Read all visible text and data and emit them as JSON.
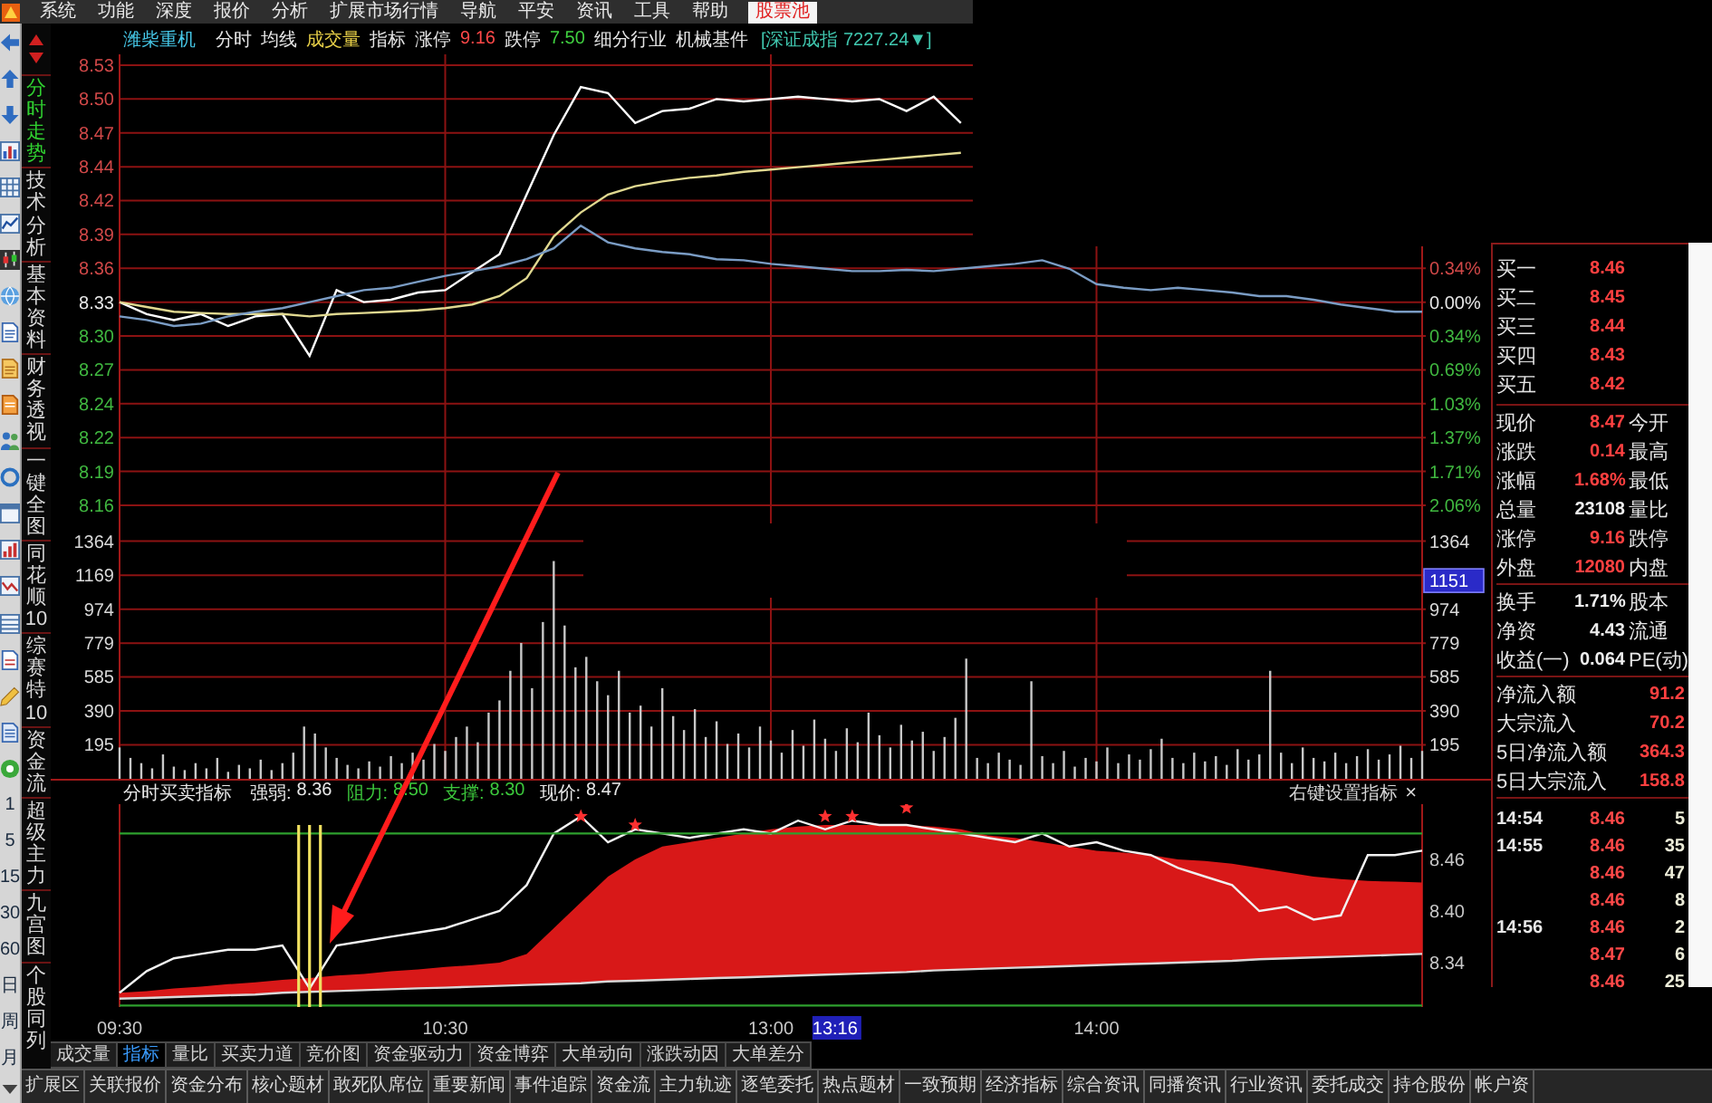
{
  "menu_bar": {
    "items": [
      {
        "label": "系统",
        "selected": false
      },
      {
        "label": "功能",
        "selected": false
      },
      {
        "label": "深度",
        "selected": false
      },
      {
        "label": "报价",
        "selected": false
      },
      {
        "label": "分析",
        "selected": false
      },
      {
        "label": "扩展市场行情",
        "selected": false
      },
      {
        "label": "导航",
        "selected": false
      },
      {
        "label": "平安",
        "selected": false
      },
      {
        "label": "资讯",
        "selected": false
      },
      {
        "label": "工具",
        "selected": false
      },
      {
        "label": "帮助",
        "selected": false
      },
      {
        "label": "股票池",
        "selected": true
      }
    ]
  },
  "toolbar": {
    "period_buttons": [
      "1",
      "5",
      "15",
      "30",
      "60",
      "日",
      "周",
      "月"
    ]
  },
  "side_tabs": [
    {
      "label": "分时走势",
      "selected": true
    },
    {
      "label": "技术分析",
      "selected": false
    },
    {
      "label": "基本资料",
      "selected": false
    },
    {
      "label": "财务透视",
      "selected": false
    },
    {
      "label": "一键全图",
      "selected": false
    },
    {
      "label": "同花顺10",
      "selected": false
    },
    {
      "label": "综赛特10",
      "selected": false
    },
    {
      "label": "资金流",
      "selected": false
    },
    {
      "label": "超级主力",
      "selected": false
    },
    {
      "label": "九宫图",
      "selected": false
    },
    {
      "label": "个股同列",
      "selected": false
    }
  ],
  "quote_header": [
    {
      "text": "潍柴重机",
      "kind": "name",
      "color": "#46c8e8"
    },
    {
      "text": "分时",
      "kind": "toggle",
      "color": "#e6e6e6"
    },
    {
      "text": "均线",
      "kind": "toggle",
      "color": "#e6e6e6"
    },
    {
      "text": "成交量",
      "kind": "toggle",
      "color": "#e8d048"
    },
    {
      "text": "指标",
      "kind": "toggle",
      "color": "#e6e6e6"
    },
    {
      "text": "涨停",
      "kind": "label",
      "color": "#e6e6e6"
    },
    {
      "text": "9.16",
      "kind": "value",
      "color": "#ff4848"
    },
    {
      "text": "跌停",
      "kind": "label",
      "color": "#e6e6e6"
    },
    {
      "text": "7.50",
      "kind": "value",
      "color": "#40d040"
    },
    {
      "text": "细分行业",
      "kind": "label",
      "color": "#e6e6e6"
    },
    {
      "text": "机械基件",
      "kind": "value",
      "color": "#e6e6e6"
    },
    {
      "text": "[深证成指 7227.24▼]",
      "kind": "index",
      "color": "#40c8b0"
    }
  ],
  "price_panel": {
    "chart_data": {
      "type": "line",
      "grid": true,
      "ylim": [
        8.1448,
        8.5374
      ],
      "yticks": [
        {
          "value": 8.5283,
          "label": "8.53"
        },
        {
          "value": 8.5,
          "label": "8.50"
        },
        {
          "value": 8.4717,
          "label": "8.47"
        },
        {
          "value": 8.4433,
          "label": "8.44"
        },
        {
          "value": 8.415,
          "label": "8.42"
        },
        {
          "value": 8.3867,
          "label": "8.39"
        },
        {
          "value": 8.3583,
          "label": "8.36"
        },
        {
          "value": 8.33,
          "label": "8.33"
        },
        {
          "value": 8.3017,
          "label": "8.30"
        },
        {
          "value": 8.2733,
          "label": "8.27"
        },
        {
          "value": 8.245,
          "label": "8.24"
        },
        {
          "value": 8.2167,
          "label": "8.22"
        },
        {
          "value": 8.1883,
          "label": "8.19"
        },
        {
          "value": 8.16,
          "label": "8.16"
        }
      ],
      "series": [
        {
          "color": "#ffffff",
          "values": [
            8.33,
            8.32,
            8.315,
            8.32,
            8.31,
            8.318,
            8.32,
            8.285,
            8.34,
            8.33,
            8.332,
            8.338,
            8.34,
            8.355,
            8.37,
            8.42,
            8.47,
            8.51,
            8.505,
            8.48,
            8.49,
            8.492,
            8.5,
            8.498,
            8.5,
            8.502,
            8.5,
            8.498,
            8.5,
            8.49,
            8.502,
            8.48,
            null,
            null,
            null,
            null,
            null,
            null,
            null,
            null,
            null,
            null,
            null,
            null,
            null,
            null,
            null,
            null,
            null
          ]
        },
        {
          "color": "#e0d890",
          "values": [
            8.33,
            8.326,
            8.322,
            8.321,
            8.32,
            8.32,
            8.32,
            8.318,
            8.32,
            8.321,
            8.322,
            8.323,
            8.325,
            8.328,
            8.335,
            8.35,
            8.385,
            8.405,
            8.42,
            8.427,
            8.431,
            8.434,
            8.436,
            8.439,
            8.441,
            8.443,
            8.445,
            8.447,
            8.449,
            8.451,
            8.453,
            8.455,
            null,
            null,
            null,
            null,
            null,
            null,
            null,
            null,
            null,
            null,
            null,
            null,
            null,
            null,
            null,
            null,
            null
          ]
        },
        {
          "color": "#7a9cc4",
          "values": [
            8.318,
            8.315,
            8.31,
            8.312,
            8.318,
            8.322,
            8.325,
            8.33,
            8.335,
            8.34,
            8.342,
            8.347,
            8.352,
            8.356,
            8.36,
            8.366,
            8.375,
            8.394,
            8.38,
            8.375,
            8.372,
            8.37,
            8.366,
            8.365,
            8.362,
            8.36,
            8.358,
            8.356,
            8.356,
            8.357,
            8.356,
            8.358,
            8.36,
            8.362,
            8.365,
            8.358,
            8.345,
            8.342,
            8.34,
            8.342,
            8.34,
            8.338,
            8.335,
            8.335,
            8.332,
            8.328,
            8.325,
            8.322,
            8.322
          ]
        }
      ]
    },
    "right_axis_labels": [
      {
        "text": "0.34%",
        "kind": "up"
      },
      {
        "text": "0.00%",
        "kind": "flat"
      },
      {
        "text": "0.34%",
        "kind": "down"
      },
      {
        "text": "0.69%",
        "kind": "down"
      },
      {
        "text": "1.03%",
        "kind": "down"
      },
      {
        "text": "1.37%",
        "kind": "down"
      },
      {
        "text": "1.71%",
        "kind": "down"
      },
      {
        "text": "2.06%",
        "kind": "down"
      }
    ]
  },
  "volume_panel": {
    "chart_data": {
      "type": "bar",
      "grid": true,
      "values": [
        180,
        120,
        90,
        60,
        140,
        70,
        50,
        90,
        60,
        120,
        40,
        80,
        60,
        110,
        50,
        90,
        150,
        300,
        260,
        180,
        120,
        80,
        60,
        100,
        70,
        130,
        90,
        150,
        110,
        200,
        160,
        240,
        300,
        210,
        380,
        450,
        620,
        780,
        520,
        900,
        1250,
        880,
        640,
        700,
        560,
        480,
        620,
        380,
        420,
        300,
        520,
        360,
        280,
        400,
        240,
        330,
        200,
        260,
        180,
        300,
        220,
        150,
        280,
        190,
        340,
        230,
        160,
        290,
        210,
        380,
        250,
        180,
        310,
        220,
        270,
        160,
        240,
        350,
        690,
        120,
        90,
        150,
        110,
        80,
        560,
        130,
        90,
        160,
        70,
        120,
        100,
        180,
        90,
        140,
        110,
        170,
        230,
        120,
        90,
        150,
        100,
        130,
        80,
        170,
        110,
        140,
        620,
        150,
        90,
        180,
        120,
        100,
        150,
        90,
        130,
        170,
        110,
        140,
        190,
        120,
        160
      ],
      "ylim": [
        0,
        1466
      ],
      "yticks": [
        {
          "value": 1364,
          "label": "1364"
        },
        {
          "value": 1169,
          "label": "1169"
        },
        {
          "value": 974,
          "label": "974"
        },
        {
          "value": 779,
          "label": "779"
        },
        {
          "value": 585,
          "label": "585"
        },
        {
          "value": 390,
          "label": "390"
        },
        {
          "value": 195,
          "label": "195"
        }
      ]
    },
    "right_axis_labels": [
      {
        "text": "1364",
        "kind": "tick"
      },
      {
        "text": "1151",
        "kind": "cursor"
      },
      {
        "text": "974",
        "kind": "tick"
      },
      {
        "text": "779",
        "kind": "tick"
      },
      {
        "text": "585",
        "kind": "tick"
      },
      {
        "text": "390",
        "kind": "tick"
      },
      {
        "text": "195",
        "kind": "tick"
      }
    ]
  },
  "indicator_panel": {
    "title": "分时买卖指标",
    "legend": [
      {
        "label": "强弱:",
        "value": "8.36",
        "color": "#e8e8e8"
      },
      {
        "label": "阻力:",
        "value": "8.50",
        "color": "#3cc83c"
      },
      {
        "label": "支撑:",
        "value": "8.30",
        "color": "#3cc83c"
      },
      {
        "label": "现价:",
        "value": "8.47",
        "color": "#e8e8e8"
      }
    ],
    "settings_link": "右键设置指标",
    "close": "×",
    "chart_data": {
      "type": "area",
      "categories": [
        "09:30",
        null,
        null,
        null,
        null,
        null,
        null,
        null,
        null,
        null,
        null,
        null,
        "10:30",
        null,
        null,
        null,
        null,
        null,
        null,
        null,
        null,
        null,
        null,
        null,
        "13:00",
        null,
        null,
        null,
        null,
        null,
        null,
        null,
        null,
        null,
        null,
        null,
        "14:00",
        null,
        null,
        null,
        null,
        null,
        null,
        null,
        null,
        null,
        null,
        null,
        null
      ],
      "ylim": [
        8.2884,
        8.5242
      ],
      "yticks": [
        {
          "value": 8.46,
          "label": "8.46"
        },
        {
          "value": 8.4,
          "label": "8.40"
        },
        {
          "value": 8.34,
          "label": "8.34"
        }
      ],
      "series": [
        {
          "type": "area",
          "color": "#d81818",
          "values": [
            8.305,
            8.307,
            8.31,
            8.312,
            8.315,
            8.317,
            8.32,
            8.322,
            8.325,
            8.327,
            8.33,
            8.332,
            8.335,
            8.337,
            8.34,
            8.35,
            8.38,
            8.41,
            8.44,
            8.46,
            8.475,
            8.48,
            8.485,
            8.49,
            8.495,
            8.498,
            8.5,
            8.5,
            8.5,
            8.5,
            8.498,
            8.495,
            8.488,
            8.485,
            8.48,
            8.475,
            8.47,
            8.468,
            8.465,
            8.46,
            8.458,
            8.455,
            8.45,
            8.445,
            8.44,
            8.437,
            8.435,
            8.434,
            8.433
          ]
        },
        {
          "type": "line",
          "color": "#d8d8d8",
          "values": [
            8.298,
            8.299,
            8.3,
            8.301,
            8.302,
            8.303,
            8.305,
            8.306,
            8.307,
            8.308,
            8.309,
            8.31,
            8.311,
            8.312,
            8.313,
            8.314,
            8.315,
            8.316,
            8.318,
            8.319,
            8.32,
            8.321,
            8.322,
            8.323,
            8.324,
            8.325,
            8.326,
            8.327,
            8.328,
            8.329,
            8.331,
            8.332,
            8.333,
            8.334,
            8.335,
            8.336,
            8.337,
            8.338,
            8.339,
            8.34,
            8.341,
            8.342,
            8.344,
            8.345,
            8.346,
            8.347,
            8.348,
            8.349,
            8.35
          ]
        },
        {
          "type": "line",
          "color": "#f2f2f2",
          "values": [
            8.305,
            8.33,
            8.345,
            8.35,
            8.355,
            8.355,
            8.36,
            8.31,
            8.36,
            8.365,
            8.37,
            8.375,
            8.38,
            8.39,
            8.4,
            8.43,
            8.49,
            8.51,
            8.48,
            8.495,
            8.49,
            8.485,
            8.49,
            8.495,
            8.49,
            8.505,
            8.495,
            8.505,
            8.5,
            8.5,
            8.495,
            8.49,
            8.485,
            8.48,
            8.49,
            8.475,
            8.48,
            8.47,
            8.465,
            8.45,
            8.44,
            8.43,
            8.4,
            8.405,
            8.39,
            8.395,
            8.465,
            8.465,
            8.47
          ]
        },
        {
          "type": "line",
          "color": "#2ea02e",
          "values": [
            8.49,
            8.49,
            8.49,
            8.49,
            8.49,
            8.49,
            8.49,
            8.49,
            8.49,
            8.49,
            8.49,
            8.49,
            8.49,
            8.49,
            8.49,
            8.49,
            8.49,
            8.49,
            8.49,
            8.49,
            8.49,
            8.49,
            8.49,
            8.49,
            8.49,
            8.49,
            8.49,
            8.49,
            8.49,
            8.49,
            8.49,
            8.49,
            8.49,
            8.49,
            8.49,
            8.49,
            8.49,
            8.49,
            8.49,
            8.49,
            8.49,
            8.49,
            8.49,
            8.49,
            8.49,
            8.49,
            8.49,
            8.49,
            8.49
          ]
        },
        {
          "type": "line",
          "color": "#2ea02e",
          "values": [
            8.29,
            8.29,
            8.29,
            8.29,
            8.29,
            8.29,
            8.29,
            8.29,
            8.29,
            8.29,
            8.29,
            8.29,
            8.29,
            8.29,
            8.29,
            8.29,
            8.29,
            8.29,
            8.29,
            8.29,
            8.29,
            8.29,
            8.29,
            8.29,
            8.29,
            8.29,
            8.29,
            8.29,
            8.29,
            8.29,
            8.29,
            8.29,
            8.29,
            8.29,
            8.29,
            8.29,
            8.29,
            8.29,
            8.29,
            8.29,
            8.29,
            8.29,
            8.29,
            8.29,
            8.29,
            8.29,
            8.29,
            8.29,
            8.29
          ]
        },
        {
          "type": "scatter",
          "color": "#ff3030",
          "values": [
            null,
            null,
            null,
            null,
            null,
            null,
            null,
            null,
            null,
            null,
            null,
            null,
            null,
            null,
            null,
            null,
            null,
            8.51,
            null,
            8.5,
            null,
            null,
            null,
            null,
            null,
            null,
            8.51,
            8.51,
            null,
            8.52,
            null,
            null,
            null,
            null,
            null,
            null,
            null,
            null,
            null,
            null,
            null,
            null,
            null,
            null,
            null,
            null,
            null,
            null,
            null
          ]
        },
        {
          "type": "bar",
          "color": "#f0e060",
          "values": [
            null,
            null,
            null,
            null,
            null,
            null,
            null,
            8.5,
            null,
            null,
            null,
            null,
            null,
            null,
            null,
            null,
            null,
            null,
            null,
            null,
            null,
            null,
            null,
            null,
            null,
            null,
            null,
            null,
            null,
            null,
            null,
            null,
            null,
            null,
            null,
            null,
            null,
            null,
            null,
            null,
            null,
            null,
            null,
            null,
            null,
            null,
            null,
            null,
            null
          ]
        }
      ],
      "annotations": [
        "13:16"
      ]
    }
  },
  "bottom_tabs": {
    "row_1": [
      {
        "label": "成交量",
        "selected": false
      },
      {
        "label": "指标",
        "selected": true
      },
      {
        "label": "量比",
        "selected": false
      },
      {
        "label": "买卖力道",
        "selected": false
      },
      {
        "label": "竞价图",
        "selected": false
      },
      {
        "label": "资金驱动力",
        "selected": false
      },
      {
        "label": "资金博弈",
        "selected": false
      },
      {
        "label": "大单动向",
        "selected": false
      },
      {
        "label": "涨跌动因",
        "selected": false
      },
      {
        "label": "大单差分",
        "selected": false
      }
    ],
    "row_2": [
      {
        "label": "扩展区",
        "selected": false
      },
      {
        "label": "关联报价",
        "selected": false
      },
      {
        "label": "资金分布",
        "selected": false
      },
      {
        "label": "核心题材",
        "selected": false
      },
      {
        "label": "敢死队席位",
        "selected": false
      },
      {
        "label": "重要新闻",
        "selected": false
      },
      {
        "label": "事件追踪",
        "selected": false
      },
      {
        "label": "资金流",
        "selected": false
      },
      {
        "label": "主力轨迹",
        "selected": false
      },
      {
        "label": "逐笔委托",
        "selected": false
      },
      {
        "label": "热点题材",
        "selected": false
      },
      {
        "label": "一致预期",
        "selected": false
      },
      {
        "label": "经济指标",
        "selected": false
      },
      {
        "label": "综合资讯",
        "selected": false
      },
      {
        "label": "同播资讯",
        "selected": false
      },
      {
        "label": "行业资讯",
        "selected": false
      },
      {
        "label": "委托成交",
        "selected": false
      },
      {
        "label": "持仓股份",
        "selected": false
      },
      {
        "label": "帐户资",
        "selected": false
      }
    ]
  },
  "quote_panel": {
    "bids": [
      {
        "label": "买一",
        "price": "8.46"
      },
      {
        "label": "买二",
        "price": "8.45"
      },
      {
        "label": "买三",
        "price": "8.44"
      },
      {
        "label": "买四",
        "price": "8.43"
      },
      {
        "label": "买五",
        "price": "8.42"
      }
    ],
    "quote_rows": [
      {
        "label": "现价",
        "value": "8.47",
        "color": "#ff4040",
        "label2": "今开"
      },
      {
        "label": "涨跌",
        "value": "0.14",
        "color": "#ff4040",
        "label2": "最高"
      },
      {
        "label": "涨幅",
        "value": "1.68%",
        "color": "#ff4040",
        "label2": "最低"
      },
      {
        "label": "总量",
        "value": "23108",
        "color": "#eeeeee",
        "label2": "量比"
      },
      {
        "label": "涨停",
        "value": "9.16",
        "color": "#ff4040",
        "label2": "跌停"
      },
      {
        "label": "外盘",
        "value": "12080",
        "color": "#ff4040",
        "label2": "内盘"
      }
    ],
    "stat_rows": [
      {
        "label": "换手",
        "value": "1.71%",
        "color": "#eeeeee",
        "label2": "股本"
      },
      {
        "label": "净资",
        "value": "4.43",
        "color": "#eeeeee",
        "label2": "流通"
      },
      {
        "label": "收益(一)",
        "value": "0.064",
        "color": "#eeeeee",
        "label2": "PE(动)"
      }
    ],
    "flow_rows": [
      {
        "label": "净流入额",
        "value": "91.2"
      },
      {
        "label": "大宗流入",
        "value": "70.2"
      },
      {
        "label": "5日净流入额",
        "value": "364.3"
      },
      {
        "label": "5日大宗流入",
        "value": "158.8"
      }
    ],
    "trades": [
      {
        "time": "14:54",
        "price": "8.46",
        "volume": "5"
      },
      {
        "time": "14:55",
        "price": "8.46",
        "volume": "35"
      },
      {
        "price": "8.46",
        "volume": "47"
      },
      {
        "price": "8.46",
        "volume": "8"
      },
      {
        "time": "14:56",
        "price": "8.46",
        "volume": "2"
      },
      {
        "price": "8.47",
        "volume": "6"
      },
      {
        "price": "8.46",
        "volume": "25"
      }
    ]
  }
}
